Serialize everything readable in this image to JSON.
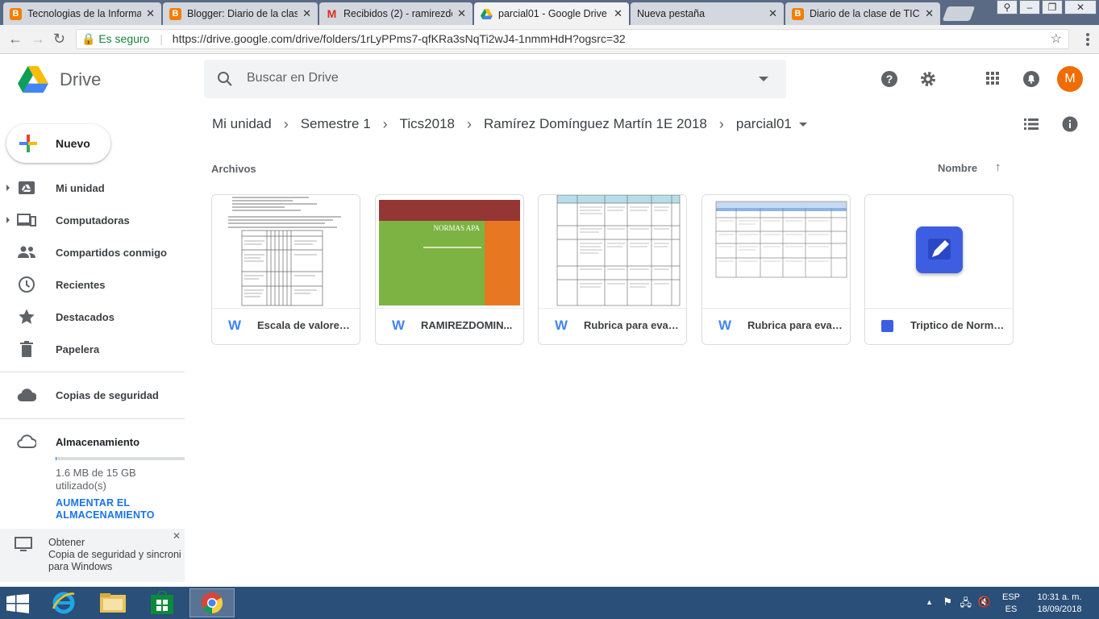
{
  "browser": {
    "tabs": [
      {
        "title": "Tecnologias de la Informa",
        "favicon": "blogger-icon",
        "active": false
      },
      {
        "title": "Blogger: Diario de la clas",
        "favicon": "blogger-icon",
        "active": false
      },
      {
        "title": "Recibidos (2) - ramirezdo",
        "favicon": "gmail-icon",
        "active": false
      },
      {
        "title": "parcial01 - Google Drive",
        "favicon": "drive-icon",
        "active": true
      },
      {
        "title": "Nueva pestaña",
        "favicon": "",
        "active": false
      },
      {
        "title": "Diario de la clase de TIC´s",
        "favicon": "blogger-icon",
        "active": false
      }
    ],
    "secure_label": "Es seguro",
    "url": "https://drive.google.com/drive/folders/1rLyPPms7-qfKRa3sNqTi2wJ4-1nmmHdH?ogsrc=32"
  },
  "drive": {
    "product_name": "Drive",
    "search_placeholder": "Buscar en Drive",
    "avatar_letter": "M",
    "new_button": "Nuevo",
    "nav": [
      {
        "label": "Mi unidad",
        "icon": "my-drive-icon",
        "expandable": true
      },
      {
        "label": "Computadoras",
        "icon": "computers-icon",
        "expandable": true
      },
      {
        "label": "Compartidos conmigo",
        "icon": "shared-icon",
        "expandable": false
      },
      {
        "label": "Recientes",
        "icon": "clock-icon",
        "expandable": false
      },
      {
        "label": "Destacados",
        "icon": "star-icon",
        "expandable": false
      },
      {
        "label": "Papelera",
        "icon": "trash-icon",
        "expandable": false
      }
    ],
    "backups_label": "Copias de seguridad",
    "storage": {
      "title": "Almacenamiento",
      "used_text": "1.6 MB de 15 GB utilizado(s)",
      "used_fraction": 0.0001,
      "upgrade_line1": "AUMENTAR EL",
      "upgrade_line2": "ALMACENAMIENTO"
    },
    "promo": {
      "line1": "Obtener",
      "line2": "Copia de seguridad y sincroni",
      "line3": "para Windows"
    },
    "breadcrumb": [
      "Mi unidad",
      "Semestre 1",
      "Tics2018",
      "Ramírez Domínguez Martín 1E 2018",
      "parcial01"
    ],
    "section_label": "Archivos",
    "sort_label": "Nombre",
    "files": [
      {
        "name": "Escala de valores ...",
        "type": "word"
      },
      {
        "name": "RAMIREZDOMIN...",
        "type": "word",
        "thumb_title": "NORMAS APA"
      },
      {
        "name": "Rubrica para eval...",
        "type": "word"
      },
      {
        "name": "Rubrica para eval...",
        "type": "word"
      },
      {
        "name": "Triptico de Norma...",
        "type": "drawing"
      }
    ]
  },
  "taskbar": {
    "lang_top": "ESP",
    "lang_bottom": "ES",
    "time": "10:31 a. m.",
    "date": "18/09/2018"
  },
  "colors": {
    "accent": "#1a73e8",
    "avatar": "#ef6c00",
    "word_blue": "#4285f4",
    "taskbar": "#2a4f78"
  }
}
